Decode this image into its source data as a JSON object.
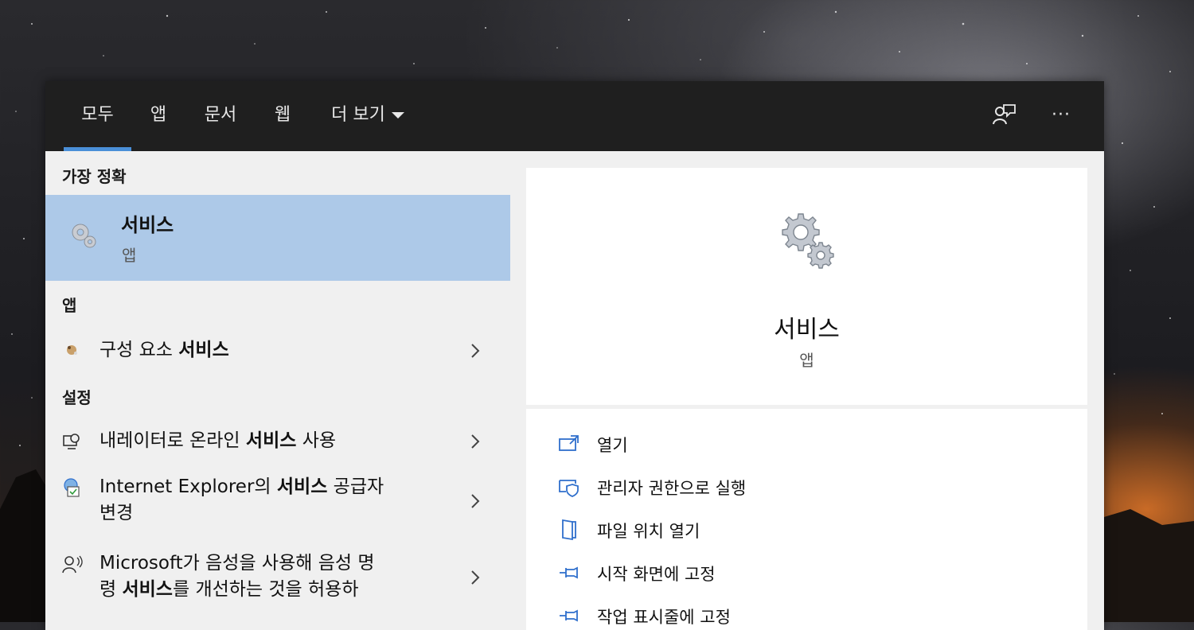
{
  "tabs": [
    {
      "label": "모두",
      "active": true
    },
    {
      "label": "앱",
      "active": false
    },
    {
      "label": "문서",
      "active": false
    },
    {
      "label": "웹",
      "active": false
    },
    {
      "label": "더 보기",
      "active": false
    }
  ],
  "top_icons": [
    "feedback-icon",
    "more-options-icon"
  ],
  "more_label": "···",
  "sections": {
    "best_match": "가장 정확",
    "apps": "앱",
    "settings": "설정"
  },
  "best_match": {
    "title": "서비스",
    "subtitle": "앱",
    "icon": "gears-icon"
  },
  "app_results": [
    {
      "prefix": "구성 요소 ",
      "bold": "서비스",
      "suffix": "",
      "icon": "component-services-icon"
    }
  ],
  "setting_results": [
    {
      "line1_prefix": "내레이터로 온라인 ",
      "line1_bold": "서비스",
      "line1_suffix": " 사용",
      "line2_prefix": "",
      "line2_bold": "",
      "line2_suffix": "",
      "icon": "narrator-icon"
    },
    {
      "line1_prefix": "Internet Explorer의 ",
      "line1_bold": "서비스",
      "line1_suffix": " 공급자",
      "line2_prefix": "변경",
      "line2_bold": "",
      "line2_suffix": "",
      "icon": "internet-options-icon"
    },
    {
      "line1_prefix": "Microsoft가 음성을 사용해 음성 명",
      "line1_bold": "",
      "line1_suffix": "",
      "line2_prefix": "령 ",
      "line2_bold": "서비스",
      "line2_suffix": "를 개선하는 것을 허용하",
      "icon": "speech-icon"
    }
  ],
  "preview": {
    "title": "서비스",
    "subtitle": "앱",
    "icon": "gears-icon"
  },
  "actions": [
    {
      "label": "열기",
      "icon": "open-icon"
    },
    {
      "label": "관리자 권한으로 실행",
      "icon": "run-as-admin-icon"
    },
    {
      "label": "파일 위치 열기",
      "icon": "file-location-icon"
    },
    {
      "label": "시작 화면에 고정",
      "icon": "pin-start-icon"
    },
    {
      "label": "작업 표시줄에 고정",
      "icon": "pin-taskbar-icon"
    }
  ],
  "colors": {
    "accent": "#4a8fd8",
    "selection": "#adc9e8",
    "topbar": "#1f1f1f",
    "action_icon": "#2f6fcc"
  }
}
